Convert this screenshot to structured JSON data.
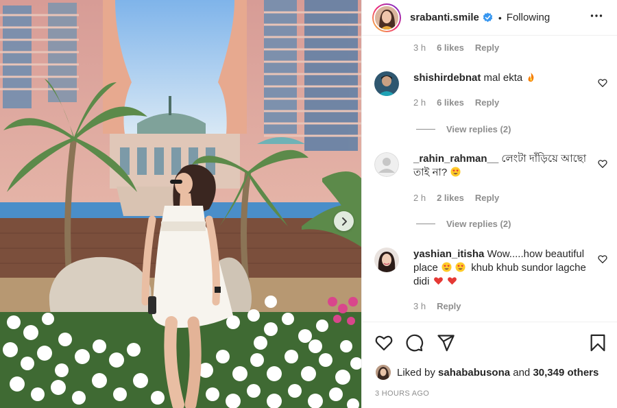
{
  "post_header": {
    "username": "srabanti.smile",
    "separator": "•",
    "follow_status": "Following"
  },
  "top_comment_meta": {
    "time": "3 h",
    "likes": "6 likes",
    "reply": "Reply"
  },
  "comments": [
    {
      "username": "shishirdebnat",
      "text": "mal ekta",
      "emoji": "fire",
      "time": "2 h",
      "likes": "6 likes",
      "reply": "Reply",
      "view_replies": "View replies (2)"
    },
    {
      "username": "_rahin_rahman__",
      "text": "লেংটা দাঁড়িয়ে আছো তাই না?",
      "emoji": "heart-eyes",
      "time": "2 h",
      "likes": "2 likes",
      "reply": "Reply",
      "view_replies": "View replies (2)"
    },
    {
      "username": "yashian_itisha",
      "text_part1": "Wow.....how beautiful place",
      "text_part2": "khub khub sundor lagche didi",
      "time": "3 h",
      "reply": "Reply"
    }
  ],
  "likes": {
    "prefix": "Liked by",
    "user": "sahababusona",
    "middle": "and",
    "count": "30,349 others"
  },
  "timestamp": "3 HOURS AGO",
  "icons": [
    "verified-badge-icon",
    "more-options-icon",
    "heart-icon",
    "comment-icon",
    "share-icon",
    "bookmark-icon",
    "next-arrow-icon"
  ],
  "colors": {
    "verified": "#3897f0",
    "muted": "#8e8e8e",
    "text": "#262626",
    "like_red": "#ed4956"
  }
}
